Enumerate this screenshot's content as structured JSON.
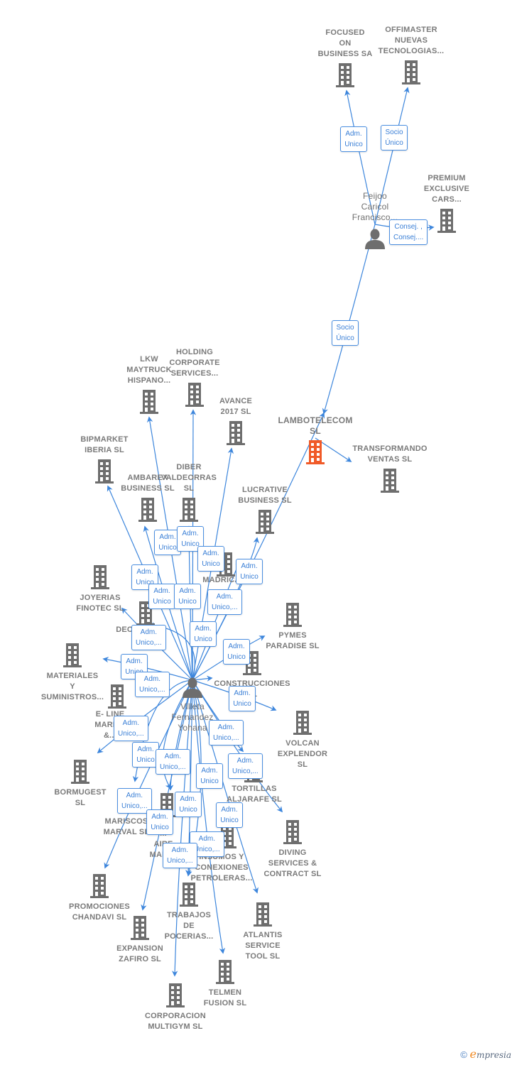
{
  "colors": {
    "edge": "#3d86dc",
    "building": "#6e6e6e",
    "focus_building": "#f05a28",
    "person": "#6e6e6e"
  },
  "footer": {
    "copyright": "©",
    "brand_initial": "e",
    "brand_rest": "mpresia"
  },
  "nodes": [
    {
      "id": "focused",
      "type": "company",
      "label": "FOCUSED\nON\nBUSINESS SA",
      "icon": "building-icon"
    },
    {
      "id": "offimaster",
      "type": "company",
      "label": "OFFIMASTER\nNUEVAS\nTECNOLOGIAS...",
      "icon": "building-icon"
    },
    {
      "id": "premium",
      "type": "company",
      "label": "PREMIUM\nEXCLUSIVE\nCARS...",
      "icon": "building-icon"
    },
    {
      "id": "feijoo",
      "type": "person",
      "label": "Feijoo\nCaricol\nFrancisco...",
      "icon": "person-icon"
    },
    {
      "id": "lambotelecom",
      "type": "focus",
      "label": "LAMBOTELECOM\nSL",
      "icon": "building-icon"
    },
    {
      "id": "transformando",
      "type": "company",
      "label": "TRANSFORMANDO\nVENTAS  SL",
      "icon": "building-icon"
    },
    {
      "id": "lkw",
      "type": "company",
      "label": "LKW\nMAYTRUCK\nHISPANO...",
      "icon": "building-icon"
    },
    {
      "id": "holding",
      "type": "company",
      "label": "HOLDING\nCORPORATE\nSERVICES...",
      "icon": "building-icon"
    },
    {
      "id": "avance",
      "type": "company",
      "label": "AVANCE\n2017  SL",
      "icon": "building-icon"
    },
    {
      "id": "bipmarket",
      "type": "company",
      "label": "BIPMARKET\nIBERIA  SL",
      "icon": "building-icon"
    },
    {
      "id": "ambarex",
      "type": "company",
      "label": "AMBAREX\nBUSINESS  SL",
      "icon": "building-icon"
    },
    {
      "id": "diber",
      "type": "company",
      "label": "DIBER\nVALDEORRAS\nSL",
      "icon": "building-icon"
    },
    {
      "id": "lucrative",
      "type": "company",
      "label": "LUCRATIVE\nBUSINESS  SL",
      "icon": "building-icon"
    },
    {
      "id": "madrican",
      "type": "company",
      "label": "MADRICAN",
      "icon": "building-icon"
    },
    {
      "id": "joyerias",
      "type": "company",
      "label": "JOYERIAS\nFINOTEC  SL",
      "icon": "building-icon"
    },
    {
      "id": "deco",
      "type": "company",
      "label": "DEC...",
      "icon": "building-icon"
    },
    {
      "id": "pymes",
      "type": "company",
      "label": "PYMES\nPARADISE  SL",
      "icon": "building-icon"
    },
    {
      "id": "construcciones",
      "type": "company",
      "label": "CONSTRUCCIONES\nSL",
      "icon": "building-icon"
    },
    {
      "id": "materiales",
      "type": "company",
      "label": "MATERIALES\nY\nSUMINISTROS...",
      "icon": "building-icon"
    },
    {
      "id": "eline",
      "type": "company",
      "label": "E- LINE\nMARK...\n&...",
      "icon": "building-icon"
    },
    {
      "id": "villeta",
      "type": "person",
      "label": "Villeta\nFernandez\nYohana",
      "icon": "person-icon"
    },
    {
      "id": "volcan",
      "type": "company",
      "label": "VOLCAN\nEXPLENDOR\nSL",
      "icon": "building-icon"
    },
    {
      "id": "bormugest",
      "type": "company",
      "label": "BORMUGEST\nSL",
      "icon": "building-icon"
    },
    {
      "id": "tortillas",
      "type": "company",
      "label": "TORTILLAS\nALJARAFE  SL",
      "icon": "building-icon"
    },
    {
      "id": "mariscos",
      "type": "company",
      "label": "MARISCOS\nMARVAL  SL",
      "icon": "building-icon"
    },
    {
      "id": "aire",
      "type": "company",
      "label": "...\nAIRE\nMADI...",
      "icon": "building-icon"
    },
    {
      "id": "diving",
      "type": "company",
      "label": "DIVING\nSERVICES &\nCONTRACT  SL",
      "icon": "building-icon"
    },
    {
      "id": "insumos",
      "type": "company",
      "label": "INSUMOS Y\nCONEXIONES\nPETROLERAS...",
      "icon": "building-icon"
    },
    {
      "id": "promociones",
      "type": "company",
      "label": "PROMOCIONES\nCHANDAVI  SL",
      "icon": "building-icon"
    },
    {
      "id": "trabajos",
      "type": "company",
      "label": "TRABAJOS\nDE\nPOCERIAS...",
      "icon": "building-icon"
    },
    {
      "id": "atlantis",
      "type": "company",
      "label": "ATLANTIS\nSERVICE\nTOOL  SL",
      "icon": "building-icon"
    },
    {
      "id": "expansion",
      "type": "company",
      "label": "EXPANSION\nZAFIRO  SL",
      "icon": "building-icon"
    },
    {
      "id": "telmen",
      "type": "company",
      "label": "TELMEN\nFUSION  SL",
      "icon": "building-icon"
    },
    {
      "id": "corporacion",
      "type": "company",
      "label": "CORPORACION\nMULTIGYM SL",
      "icon": "building-icon"
    }
  ],
  "edges": [
    {
      "from": "feijoo",
      "to": "focused",
      "label": "Adm.\nUnico"
    },
    {
      "from": "feijoo",
      "to": "offimaster",
      "label": "Socio\nÚnico"
    },
    {
      "from": "feijoo",
      "to": "premium",
      "label": "Consej. ,\nConsej...."
    },
    {
      "from": "feijoo",
      "to": "lambotelecom",
      "label": "Socio\nÚnico"
    },
    {
      "from": "lambotelecom",
      "to": "transformando",
      "label": ""
    },
    {
      "from": "villeta",
      "to": "lkw",
      "label": "Adm.\nUnico"
    },
    {
      "from": "villeta",
      "to": "holding",
      "label": "Adm.\nUnico"
    },
    {
      "from": "villeta",
      "to": "avance",
      "label": "Adm.\nUnico"
    },
    {
      "from": "villeta",
      "to": "bipmarket",
      "label": "Adm.\nUnico"
    },
    {
      "from": "villeta",
      "to": "ambarex",
      "label": "Adm.\nUnico"
    },
    {
      "from": "villeta",
      "to": "diber",
      "label": "Adm.\nUnico"
    },
    {
      "from": "villeta",
      "to": "lucrative",
      "label": "Adm.\nUnico"
    },
    {
      "from": "villeta",
      "to": "lambotelecom",
      "label": "Adm.\nUnico"
    },
    {
      "from": "villeta",
      "to": "madrican",
      "label": "Adm.\nUnico,..."
    },
    {
      "from": "villeta",
      "to": "joyerias",
      "label": "Adm.\nUnico,..."
    },
    {
      "from": "villeta",
      "to": "deco",
      "label": "Adm.\nUnico"
    },
    {
      "from": "villeta",
      "to": "pymes",
      "label": "Adm.\nUnico"
    },
    {
      "from": "villeta",
      "to": "construcciones",
      "label": ""
    },
    {
      "from": "villeta",
      "to": "materiales",
      "label": "Adm.\nUnico"
    },
    {
      "from": "villeta",
      "to": "eline",
      "label": "Adm.\nUnico,..."
    },
    {
      "from": "villeta",
      "to": "volcan",
      "label": "Adm.\nUnico"
    },
    {
      "from": "villeta",
      "to": "bormugest",
      "label": "Adm.\nUnico,..."
    },
    {
      "from": "villeta",
      "to": "tortillas",
      "label": "Adm.\nUnico,..."
    },
    {
      "from": "villeta",
      "to": "diving",
      "label": "Adm.\nUnico,..."
    },
    {
      "from": "villeta",
      "to": "mariscos",
      "label": "Adm.\nUnico"
    },
    {
      "from": "villeta",
      "to": "aire",
      "label": "Adm.\nUnico,..."
    },
    {
      "from": "villeta",
      "to": "insumos",
      "label": "Adm.\nUnico"
    },
    {
      "from": "villeta",
      "to": "promociones",
      "label": "Adm.\nUnico,..."
    },
    {
      "from": "villeta",
      "to": "trabajos",
      "label": "Adm.\nUnico"
    },
    {
      "from": "villeta",
      "to": "atlantis",
      "label": "Adm.\nUnico"
    },
    {
      "from": "villeta",
      "to": "expansion",
      "label": "Adm.\nUnico"
    },
    {
      "from": "villeta",
      "to": "telmen",
      "label": "Adm.\nUnico,..."
    },
    {
      "from": "villeta",
      "to": "corporacion",
      "label": "Adm.\nUnico,..."
    }
  ]
}
